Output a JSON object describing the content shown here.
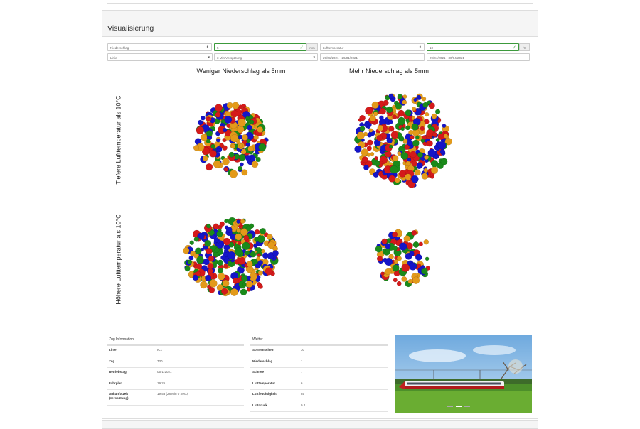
{
  "panel": {
    "title": "Visualisierung"
  },
  "controls": {
    "row1": [
      {
        "name": "variable-1-select",
        "value": "Niederschlag",
        "kind": "select"
      },
      {
        "name": "threshold-1-input",
        "value": "5",
        "kind": "input-valid"
      },
      {
        "name": "threshold-1-unit",
        "value": "mm",
        "kind": "addon"
      },
      {
        "name": "variable-2-select",
        "value": "Lufttemperatur",
        "kind": "select"
      },
      {
        "name": "threshold-2-input",
        "value": "10",
        "kind": "input-valid"
      },
      {
        "name": "threshold-2-unit",
        "value": "°C",
        "kind": "addon"
      }
    ],
    "row2": [
      {
        "name": "line-select",
        "value": "Linie",
        "kind": "select"
      },
      {
        "name": "delay-select",
        "value": "3 Min Verspätung",
        "kind": "select"
      },
      {
        "name": "date-range-1-input",
        "value": "29/01/2021 - 29/01/2021",
        "kind": "input"
      },
      {
        "name": "date-range-2-input",
        "value": "29/04/2021 - 30/04/2021",
        "kind": "input"
      }
    ]
  },
  "chart_data": {
    "type": "bubble-grid",
    "columns": [
      "Weniger Niederschlag als 5mm",
      "Mehr Niederschlag als 5mm"
    ],
    "rows": [
      "Tiefere Lufttemperatur als 10°C",
      "Höhere Lufttemperatur als 10°C"
    ],
    "palette": [
      "#1515c8",
      "#1a8a1a",
      "#e39a1a",
      "#d41a1a"
    ],
    "cells": [
      {
        "row": 0,
        "col": 0,
        "count": 230,
        "relative_size": 0.78
      },
      {
        "row": 0,
        "col": 1,
        "count": 330,
        "relative_size": 1.0
      },
      {
        "row": 1,
        "col": 0,
        "count": 300,
        "relative_size": 0.88
      },
      {
        "row": 1,
        "col": 1,
        "count": 90,
        "relative_size": 0.62
      }
    ]
  },
  "zug_information": {
    "header": "Zug Information",
    "rows": [
      {
        "key": "Linie",
        "value": "IC1"
      },
      {
        "key": "Zug",
        "value": "730"
      },
      {
        "key": "Betriebstag",
        "value": "05-1-2021"
      },
      {
        "key": "Fahrplan",
        "value": "19:25"
      },
      {
        "key": "Ankunftszeit (Verspätung)",
        "value": "19:53 (28 Min 0 Seco)"
      }
    ]
  },
  "wetter": {
    "header": "Wetter",
    "rows": [
      {
        "key": "Sonnenschein",
        "value": "30"
      },
      {
        "key": "Niederschlag",
        "value": "1"
      },
      {
        "key": "Schnee",
        "value": "7"
      },
      {
        "key": "Lufttemperatur",
        "value": "6"
      },
      {
        "key": "Luftfeuchtigkeit",
        "value": "85"
      },
      {
        "key": "Luftdruck",
        "value": "9.2"
      }
    ]
  },
  "photo": {
    "slides": 3,
    "active": 1
  }
}
